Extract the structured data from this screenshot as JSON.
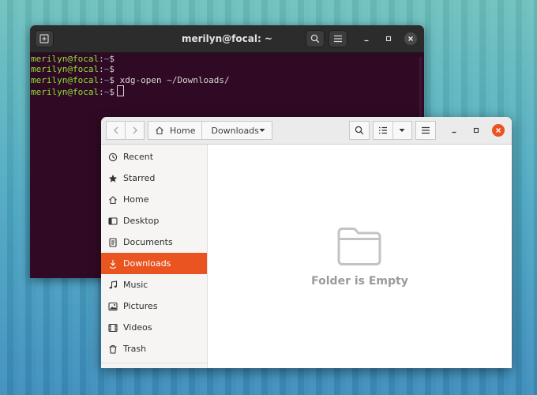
{
  "terminal": {
    "title": "merilyn@focal: ~",
    "lines": [
      {
        "user": "merilyn@focal",
        "path": "~",
        "command": ""
      },
      {
        "user": "merilyn@focal",
        "path": "~",
        "command": ""
      },
      {
        "user": "merilyn@focal",
        "path": "~",
        "command": "xdg-open ~/Downloads/"
      },
      {
        "user": "merilyn@focal",
        "path": "~",
        "command": ""
      }
    ],
    "prompt_sep": ":",
    "prompt_end": "$",
    "header_icons": [
      "new-tab-icon",
      "search-icon",
      "hamburger-menu-icon",
      "minimize-icon",
      "maximize-icon",
      "close-icon"
    ]
  },
  "files": {
    "path": {
      "home": "Home",
      "current": "Downloads"
    },
    "sidebar": [
      {
        "label": "Recent",
        "icon": "clock-icon",
        "active": false
      },
      {
        "label": "Starred",
        "icon": "star-icon",
        "active": false
      },
      {
        "label": "Home",
        "icon": "home-icon",
        "active": false
      },
      {
        "label": "Desktop",
        "icon": "desktop-icon",
        "active": false
      },
      {
        "label": "Documents",
        "icon": "document-icon",
        "active": false
      },
      {
        "label": "Downloads",
        "icon": "download-icon",
        "active": true
      },
      {
        "label": "Music",
        "icon": "music-note-icon",
        "active": false
      },
      {
        "label": "Pictures",
        "icon": "picture-icon",
        "active": false
      },
      {
        "label": "Videos",
        "icon": "video-icon",
        "active": false
      },
      {
        "label": "Trash",
        "icon": "trash-icon",
        "active": false
      }
    ],
    "empty_message": "Folder is Empty"
  },
  "colors": {
    "accent": "#e95420",
    "terminal_bg": "#300a24",
    "prompt_user": "#8ae234",
    "prompt_path": "#729fcf"
  }
}
